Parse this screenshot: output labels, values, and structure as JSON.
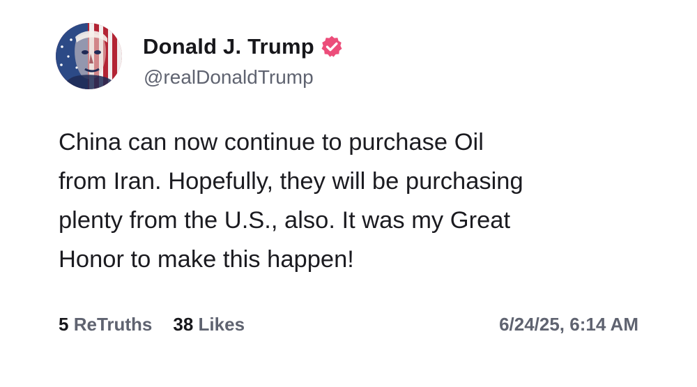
{
  "author": {
    "display_name": "Donald J. Trump",
    "handle": "@realDonaldTrump",
    "verified_icon": "verified-badge-icon",
    "verified_color": "#ec4d7a",
    "avatar_icon": "flag-portrait-avatar"
  },
  "post": {
    "lines": [
      "China can now continue to purchase Oil",
      "from Iran. Hopefully, they will be purchasing",
      "plenty from the U.S., also. It was my Great",
      "Honor to make this happen!"
    ]
  },
  "stats": {
    "retruths_count": "5",
    "retruths_label": "ReTruths",
    "likes_count": "38",
    "likes_label": "Likes",
    "timestamp": "6/24/25, 6:14 AM"
  }
}
